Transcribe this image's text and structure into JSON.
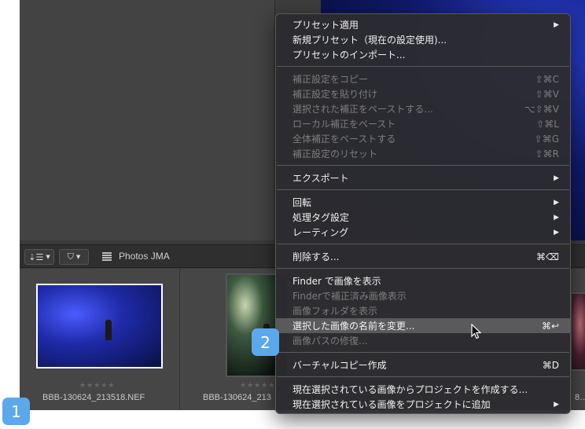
{
  "browser": {
    "sort_label": "⇣☰",
    "filter_label": "⛉",
    "project_name": "Photos JMA"
  },
  "filmstrip": {
    "thumbnails": [
      {
        "filename": "BBB-130624_213518.NEF",
        "stars": "★★★★★"
      },
      {
        "filename": "BBB-130624_213",
        "stars": "★★★★★"
      },
      {
        "filename": "8…"
      }
    ]
  },
  "menu": {
    "apply_preset": "プリセット適用",
    "new_preset": "新規プリセット（現在の設定使用)...",
    "import_presets": "プリセットのインポート...",
    "copy_adjustments": "補正設定をコピー",
    "copy_adjustments_sc": "⇧⌘C",
    "paste_adjustments": "補正設定を貼り付け",
    "paste_adjustments_sc": "⇧⌘V",
    "paste_selected": "選択された補正をペーストする...",
    "paste_selected_sc": "⌥⇧⌘V",
    "paste_local": "ローカル補正をペースト",
    "paste_local_sc": "⇧⌘L",
    "paste_global": "全体補正をペーストする",
    "paste_global_sc": "⇧⌘G",
    "reset_adjustments": "補正設定のリセット",
    "reset_adjustments_sc": "⇧⌘R",
    "export": "エクスポート",
    "rotate": "回転",
    "process_tags": "処理タグ設定",
    "rating": "レーティング",
    "delete": "削除する...",
    "delete_sc": "⌘⌫",
    "show_in_finder": "Finder で画像を表示",
    "show_processed": "Finderで補正済み画像表示",
    "show_folder": "画像フォルダを表示",
    "rename_selected": "選択した画像の名前を変更...",
    "rename_selected_sc": "⌘↩",
    "repair_path": "画像パスの修復...",
    "virtual_copy": "バーチャルコピー作成",
    "virtual_copy_sc": "⌘D",
    "create_project": "現在選択されている画像からプロジェクトを作成する...",
    "add_to_project": "現在選択されている画像をプロジェクトに追加"
  },
  "badges": {
    "one": "1",
    "two": "2"
  },
  "colors": {
    "badge": "#5ba8ec",
    "menu_bg": "#2c2c30",
    "highlight": "#5a5a5c",
    "thumb_border_selected": "#ffffff"
  }
}
